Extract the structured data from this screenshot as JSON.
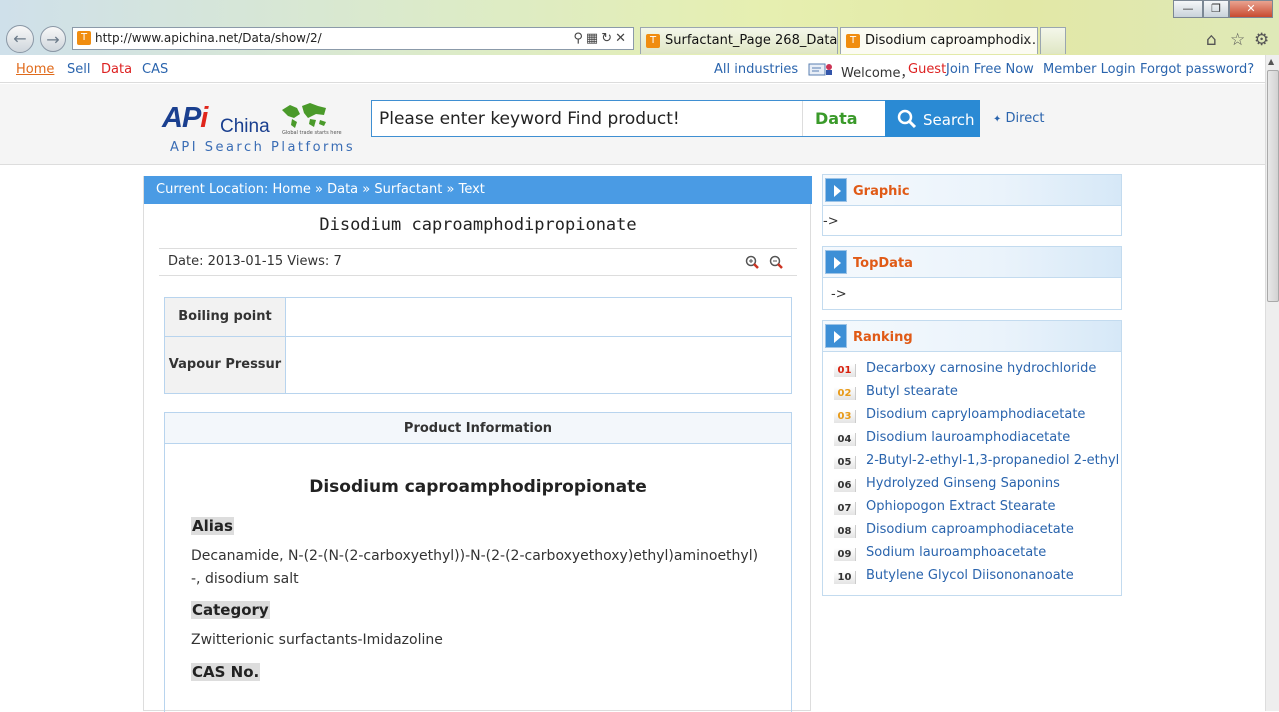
{
  "browser": {
    "address": "http://www.apichina.net/Data/show/2/",
    "tabs": [
      {
        "label": "Surfactant_Page 268_Data_A..."
      },
      {
        "label": "Disodium caproamphodi..."
      }
    ],
    "tab_close": "x",
    "window_minimize": "—",
    "window_restore": "❐",
    "window_close": "✕"
  },
  "topbar": {
    "links": [
      "Home",
      "Sell",
      "Data",
      "CAS"
    ],
    "all_industries": "All industries",
    "welcome": "Welcome，",
    "guest": "Guest",
    "join": "Join Free Now",
    "login": "Member Login",
    "forgot": "Forgot password?"
  },
  "header": {
    "logo_api": "AP",
    "logo_i": "i",
    "logo_china": "China",
    "logo_tagline": "Global trade starts here",
    "logo_sub": "API Search Platforms",
    "search_keyword": "Please enter keyword Find product!",
    "search_category": "Data",
    "search_button": "Search",
    "direct": "Direct"
  },
  "breadcrumb": {
    "prefix": "Current Location:",
    "items": [
      "Home",
      "Data",
      "Surfactant",
      "Text"
    ],
    "sep": "»"
  },
  "article": {
    "title": "Disodium caproamphodipropionate",
    "date_label": "Date:",
    "date": "2013-01-15",
    "views_label": "Views:",
    "views": "7"
  },
  "properties": [
    {
      "key": "Boiling point",
      "value": ""
    },
    {
      "key": "Vapour Pressur",
      "value": ""
    }
  ],
  "product_info": {
    "heading": "Product Information",
    "name": "Disodium caproamphodipropionate",
    "alias_label": "Alias",
    "alias": "Decanamide, N-(2-(N-(2-carboxyethyl))-N-(2-(2-carboxyethoxy)ethyl)aminoethyl)-, disodium salt",
    "category_label": "Category",
    "category": "Zwitterionic surfactants-Imidazoline",
    "cas_label": "CAS No."
  },
  "sidebar": {
    "graphic_title": "Graphic",
    "graphic_body": "->",
    "topdata_title": "TopData",
    "topdata_body": "->",
    "ranking_title": "Ranking",
    "ranking": [
      {
        "n": "01",
        "label": "Decarboxy carnosine hydrochloride"
      },
      {
        "n": "02",
        "label": "Butyl stearate"
      },
      {
        "n": "03",
        "label": "Disodium capryloamphodiacetate"
      },
      {
        "n": "04",
        "label": "Disodium lauroamphodiacetate"
      },
      {
        "n": "05",
        "label": "2-Butyl-2-ethyl-1,3-propanediol 2-ethyl"
      },
      {
        "n": "06",
        "label": "Hydrolyzed Ginseng Saponins"
      },
      {
        "n": "07",
        "label": "Ophiopogon Extract Stearate"
      },
      {
        "n": "08",
        "label": "Disodium caproamphodiacetate"
      },
      {
        "n": "09",
        "label": "Sodium lauroamphoacetate"
      },
      {
        "n": "10",
        "label": "Butylene Glycol Diisononanoate"
      }
    ]
  }
}
